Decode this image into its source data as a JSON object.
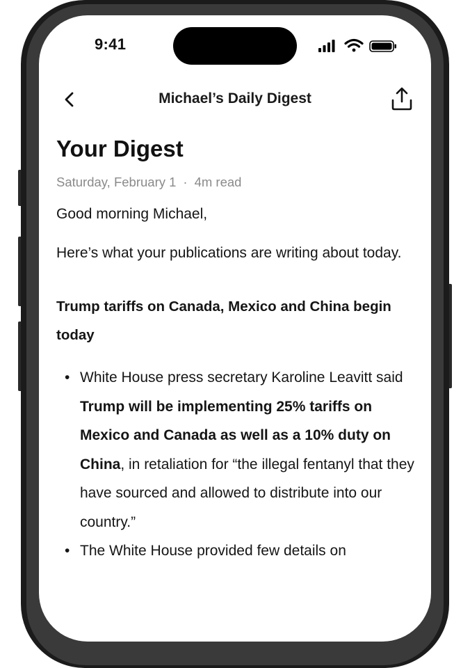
{
  "status_bar": {
    "time": "9:41",
    "icons": [
      "cellular-signal-icon",
      "wifi-icon",
      "battery-icon"
    ]
  },
  "nav": {
    "title": "Michael’s Daily Digest",
    "back_icon": "chevron-left-icon",
    "share_icon": "share-icon"
  },
  "article": {
    "title": "Your Digest",
    "date": "Saturday, February 1",
    "separator": "·",
    "read_time": "4m read",
    "greeting": "Good morning Michael,",
    "intro": "Here’s what your publications are writing about today.",
    "headline": "Trump tariffs on Canada, Mexico and China begin today",
    "bullets": [
      {
        "prefix": "White House press secretary Karoline Leavitt said ",
        "bold": "Trump will be implementing 25% tariffs on Mexico and Canada as well as a 10% duty on China",
        "suffix": ", in retaliation for “the illegal fentanyl that they have sourced and allowed to distribute into our country.”"
      },
      {
        "prefix": "The White House provided few details on",
        "bold": "",
        "suffix": ""
      }
    ]
  },
  "colors": {
    "frame": "#1b1b1b",
    "screen": "#ffffff",
    "text": "#111111",
    "meta": "#8a8a8a"
  }
}
